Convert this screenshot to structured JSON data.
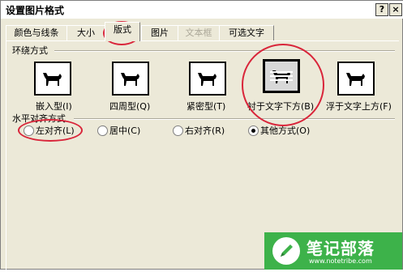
{
  "titlebar": {
    "title": "设置图片格式",
    "help_label": "?",
    "close_label": "×"
  },
  "tabs": [
    {
      "label": "颜色与线条"
    },
    {
      "label": "大小"
    },
    {
      "label": "版式"
    },
    {
      "label": "图片"
    },
    {
      "label": "文本框"
    },
    {
      "label": "可选文字"
    }
  ],
  "active_tab": "版式",
  "wrap_section": {
    "heading": "环绕方式",
    "options": [
      {
        "label": "嵌入型(I)",
        "icon": "dog-inline-icon"
      },
      {
        "label": "四周型(Q)",
        "icon": "dog-square-icon"
      },
      {
        "label": "紧密型(T)",
        "icon": "dog-tight-icon"
      },
      {
        "label": "衬于文字下方(B)",
        "icon": "dog-behind-text-icon"
      },
      {
        "label": "浮于文字上方(F)",
        "icon": "dog-in-front-icon"
      }
    ],
    "selected": "衬于文字下方(B)"
  },
  "align_section": {
    "heading": "水平对齐方式",
    "options": [
      {
        "label": "左对齐(L)"
      },
      {
        "label": "居中(C)"
      },
      {
        "label": "右对齐(R)"
      },
      {
        "label": "其他方式(O)"
      }
    ],
    "selected": "其他方式(O)"
  },
  "watermark": {
    "text": "笔记部落",
    "url": "www.notetribe.com"
  },
  "colors": {
    "dialog_bg": "#ece9d8",
    "annotation": "#d9253a",
    "watermark": "#3db24a"
  }
}
